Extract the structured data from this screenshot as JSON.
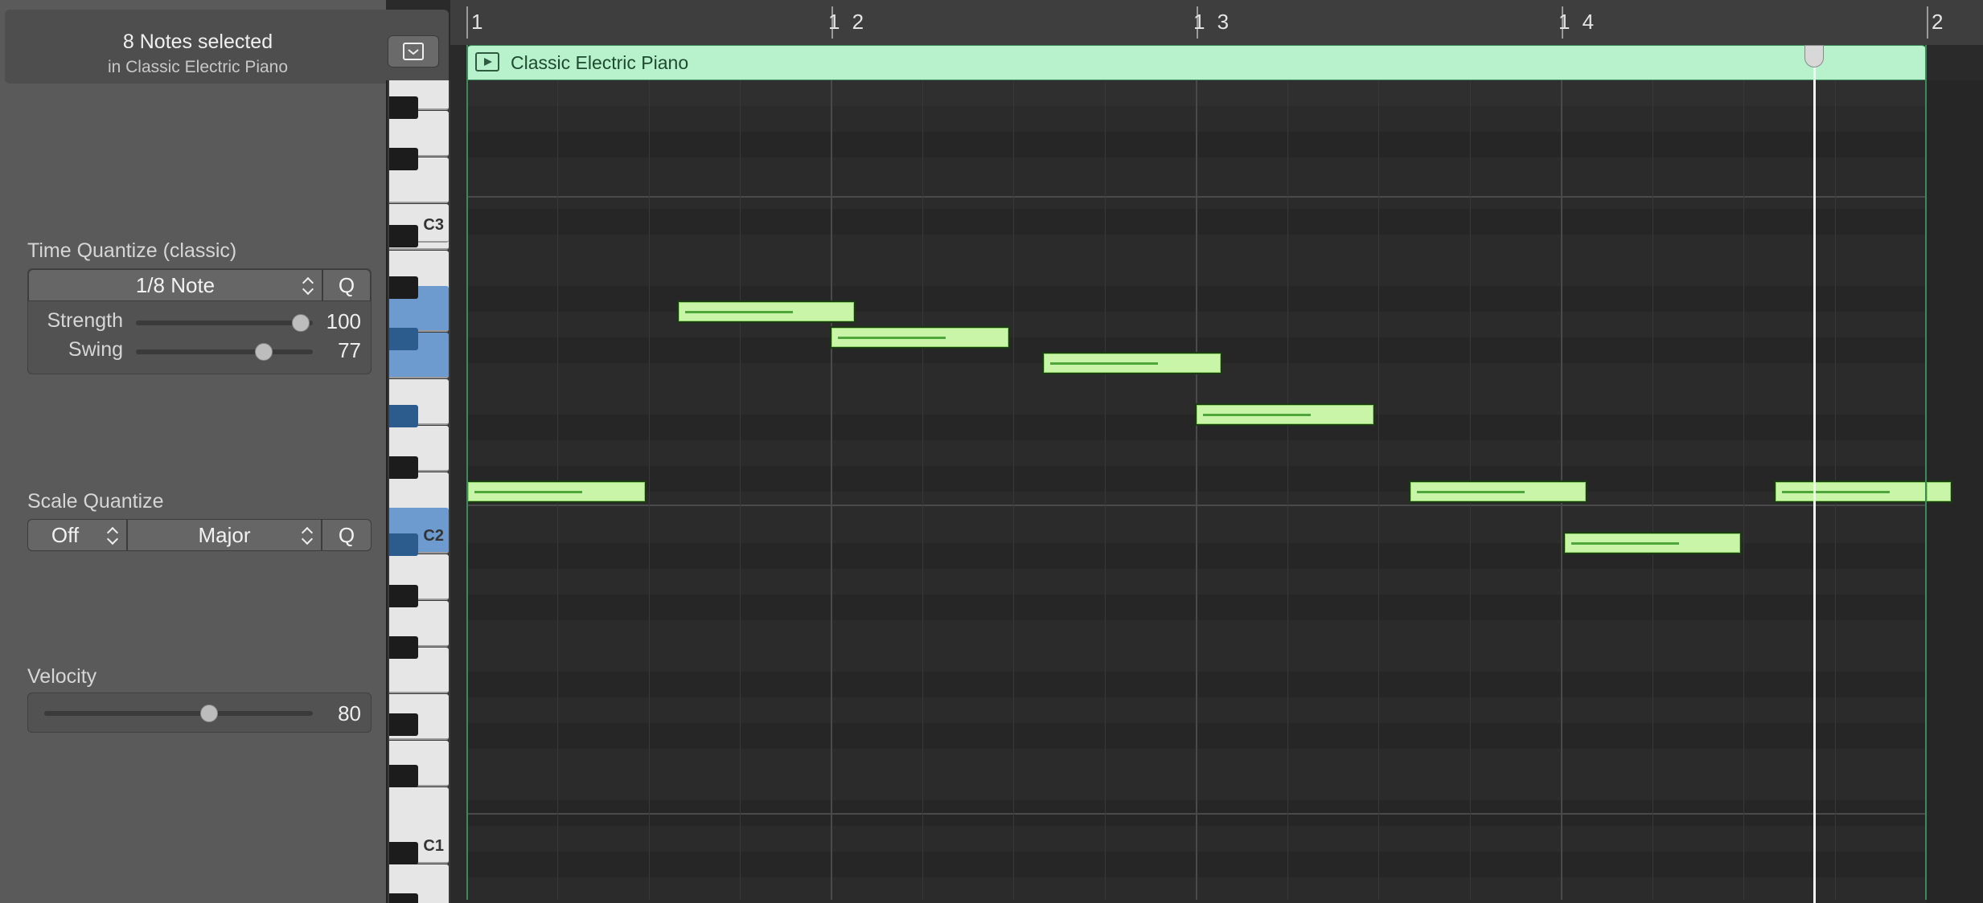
{
  "inspector": {
    "selection_title": "8 Notes selected",
    "selection_subtitle": "in Classic Electric Piano",
    "time_quantize": {
      "label": "Time Quantize (classic)",
      "value": "1/8 Note",
      "q_label": "Q",
      "strength_label": "Strength",
      "strength_value": "100",
      "swing_label": "Swing",
      "swing_value": "77"
    },
    "scale_quantize": {
      "label": "Scale Quantize",
      "root": "Off",
      "scale": "Major",
      "q_label": "Q"
    },
    "velocity": {
      "label": "Velocity",
      "value": "80"
    }
  },
  "keyboard": {
    "labels": {
      "c3": "C3",
      "c2": "C2",
      "c1": "C1"
    }
  },
  "ruler": {
    "bars": [
      "1",
      "1 2",
      "1 3",
      "1 4",
      "2"
    ]
  },
  "region": {
    "name": "Classic Electric Piano",
    "color": "#b8f2cc"
  },
  "colors": {
    "note_fill": "#c8f5a8",
    "selected_key": "#6d9bd0",
    "velocity_line": "#4ea53a"
  }
}
